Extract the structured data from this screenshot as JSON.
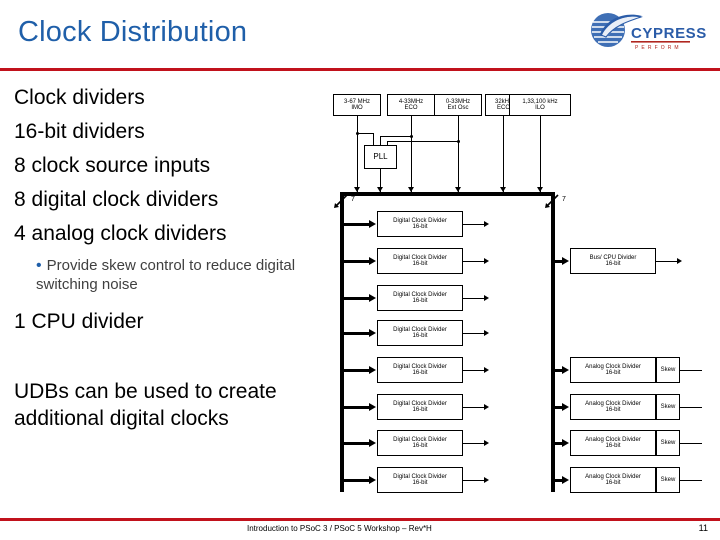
{
  "slide": {
    "title": "Clock Distribution",
    "accent_color": "#c1121c",
    "title_color": "#1f5fa9"
  },
  "logo": {
    "name": "Cypress",
    "wordmark": "CYPRESS",
    "tagline": "PERFORM"
  },
  "bullets": [
    {
      "text": "Clock dividers"
    },
    {
      "text": "16-bit dividers"
    },
    {
      "text": "8 clock source inputs"
    },
    {
      "text": "8 digital clock dividers"
    },
    {
      "text": "4 analog clock dividers"
    }
  ],
  "subbullet": {
    "marker": "•",
    "text": "Provide skew control to reduce digital switching noise"
  },
  "bullets_after": [
    {
      "text": "1 CPU divider"
    },
    {
      "text": "UDBs can be used to create additional digital clocks"
    }
  ],
  "diagram": {
    "sources": [
      {
        "line1": "3-67 MHz",
        "line2": "IMO"
      },
      {
        "line1": "4-33MHz",
        "line2": "ECO"
      },
      {
        "line1": "0-33MHz",
        "line2": "Ext Osc"
      },
      {
        "line1": "32kHz",
        "line2": "ECO"
      },
      {
        "line1": "1,33,100 kHz",
        "line2": "ILO"
      }
    ],
    "pll": {
      "label": "PLL"
    },
    "bus_width_labels": [
      "7",
      "7"
    ],
    "digital_dividers": [
      {
        "line1": "Digital Clock Divider",
        "line2": "16-bit"
      },
      {
        "line1": "Digital Clock Divider",
        "line2": "16-bit"
      },
      {
        "line1": "Digital Clock Divider",
        "line2": "16-bit"
      },
      {
        "line1": "Digital Clock Divider",
        "line2": "16-bit"
      },
      {
        "line1": "Digital Clock Divider",
        "line2": "16-bit"
      },
      {
        "line1": "Digital Clock Divider",
        "line2": "16-bit"
      },
      {
        "line1": "Digital Clock Divider",
        "line2": "16-bit"
      },
      {
        "line1": "Digital Clock Divider",
        "line2": "16-bit"
      }
    ],
    "bus_cpu_divider": {
      "line1": "Bus/ CPU Divider",
      "line2": "16-bit"
    },
    "analog_dividers": [
      {
        "line1": "Analog Clock Divider",
        "line2": "16-bit",
        "skew": "Skew"
      },
      {
        "line1": "Analog Clock Divider",
        "line2": "16-bit",
        "skew": "Skew"
      },
      {
        "line1": "Analog Clock Divider",
        "line2": "16-bit",
        "skew": "Skew"
      },
      {
        "line1": "Analog Clock Divider",
        "line2": "16-bit",
        "skew": "Skew"
      }
    ]
  },
  "footer": {
    "text": "Introduction to PSoC 3 / PSoC 5 Workshop – Rev*H",
    "page": "11"
  }
}
